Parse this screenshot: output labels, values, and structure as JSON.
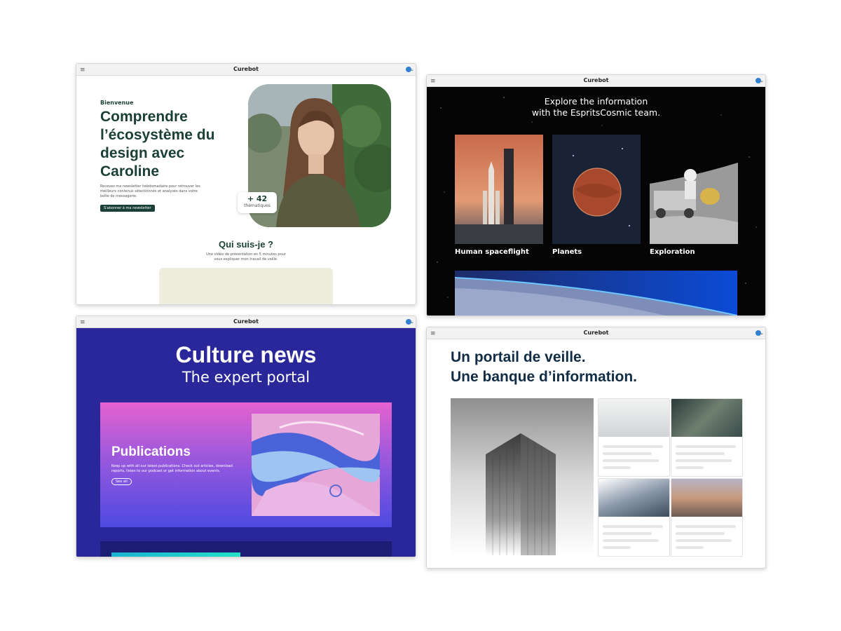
{
  "windows": [
    {
      "title": "Curebot",
      "welcome": "Bienvenue",
      "heading": "Comprendre l’écosystème du design avec Caroline",
      "description": "Recevez ma newsletter hebdomadaire pour retrouver les meilleurs contenus sélectionnés et analysés dans votre boîte de messagerie.",
      "cta": "S'abonner à ma newsletter",
      "stat_value": "+ 42",
      "stat_label": "thématiques",
      "section_title": "Qui suis-je ?",
      "section_sub": "Une vidéo de présentation en 5 minutes pour vous expliquer mon travail de veille."
    },
    {
      "title": "Curebot",
      "heading_line1": "Explore the information",
      "heading_line2": "with the EspritsCosmic team.",
      "cards": [
        "Human spaceflight",
        "Planets",
        "Exploration"
      ]
    },
    {
      "title": "Curebot",
      "heading": "Culture news",
      "subheading": "The expert portal",
      "panel_title": "Publications",
      "panel_text": "Keep up with all our latest publications. Check out articles, download reports, listen to our podcast or get information about events.",
      "see_all": "See all"
    },
    {
      "title": "Curebot",
      "heading_line1": "Un portail de veille.",
      "heading_line2": "Une banque d’information."
    }
  ],
  "colors": {
    "dark_green": "#1a3f36",
    "indigo": "#29279a",
    "navy": "#112c45",
    "profile_blue": "#2f80d1"
  },
  "icons": [
    "menu-icon",
    "profile-icon",
    "chevron-down-icon"
  ]
}
